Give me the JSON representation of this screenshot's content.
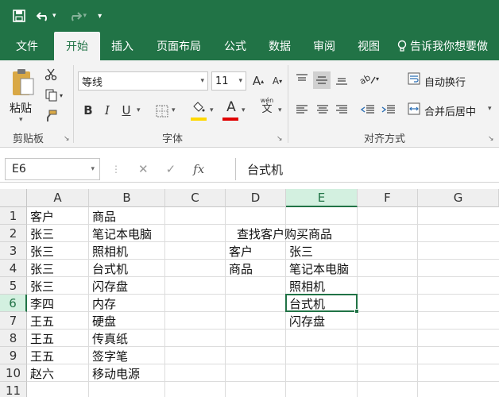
{
  "qat": {
    "save": "save-icon",
    "undo": "undo-icon",
    "redo": "redo-icon",
    "customize": "customize-icon"
  },
  "tabs": [
    {
      "label": "文件"
    },
    {
      "label": "开始"
    },
    {
      "label": "插入"
    },
    {
      "label": "页面布局"
    },
    {
      "label": "公式"
    },
    {
      "label": "数据"
    },
    {
      "label": "审阅"
    },
    {
      "label": "视图"
    },
    {
      "label": "告诉我你想要做"
    }
  ],
  "ribbon": {
    "clipboard": {
      "paste": "粘贴",
      "label": "剪贴板"
    },
    "font": {
      "name": "等线",
      "size": "11",
      "bold": "B",
      "italic": "I",
      "underline": "U",
      "font_color_glyph": "A",
      "grow": "A",
      "shrink": "A",
      "wen": "wén",
      "wen_char": "文",
      "label": "字体"
    },
    "alignment": {
      "wrap": "自动换行",
      "merge": "合并后居中",
      "label": "对齐方式"
    }
  },
  "formula_bar": {
    "name_box": "E6",
    "fx": "fx",
    "content": "台式机"
  },
  "columns": [
    "A",
    "B",
    "C",
    "D",
    "E",
    "F",
    "G"
  ],
  "rows": [
    "1",
    "2",
    "3",
    "4",
    "5",
    "6",
    "7",
    "8",
    "9",
    "10",
    "11"
  ],
  "cells": {
    "A1": "客户",
    "B1": "商品",
    "A2": "张三",
    "B2": "笔记本电脑",
    "D2": "查找客户购买商品",
    "A3": "张三",
    "B3": "照相机",
    "D3": "客户",
    "E3": "张三",
    "A4": "张三",
    "B4": "台式机",
    "D4": "商品",
    "E4": "笔记本电脑",
    "A5": "张三",
    "B5": "闪存盘",
    "E5": "照相机",
    "A6": "李四",
    "B6": "内存",
    "E6": "台式机",
    "A7": "王五",
    "B7": "硬盘",
    "E7": "闪存盘",
    "A8": "王五",
    "B8": "传真纸",
    "A9": "王五",
    "B9": "签字笔",
    "A10": "赵六",
    "B10": "移动电源"
  },
  "colors": {
    "accent": "#217346",
    "selection_header": "#d3f0e0",
    "highlight_yellow": "#ffd800",
    "font_red": "#e00000"
  },
  "selected_cell": "E6"
}
